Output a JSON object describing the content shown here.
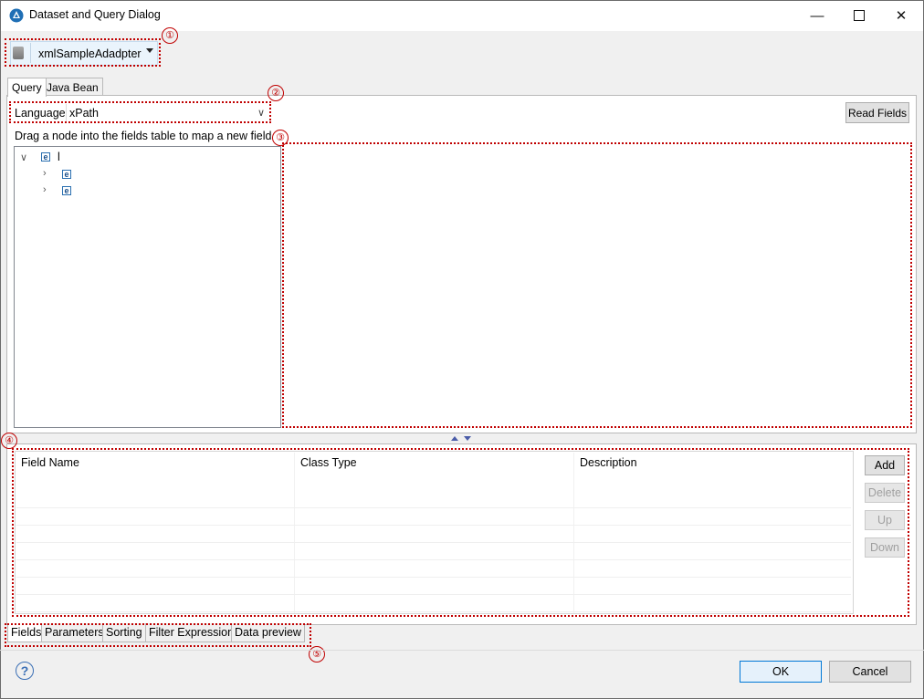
{
  "window": {
    "title": "Dataset and Query Dialog",
    "minimize_icon": "minimize-icon",
    "maximize_icon": "maximize-icon",
    "close_icon": "close-icon"
  },
  "adapter": {
    "selected": "xmlSampleAdadpter",
    "icon": "database-icon"
  },
  "callouts": [
    "①",
    "②",
    "③",
    "④",
    "⑤"
  ],
  "query_tabs": [
    {
      "label": "Query",
      "active": true
    },
    {
      "label": "Java Bean",
      "active": false
    }
  ],
  "language": {
    "label": "Language",
    "value": "xPath"
  },
  "read_fields_label": "Read Fields",
  "drag_hint": "Drag a node into the fields table to map a new field",
  "tree": {
    "root": {
      "label": "l",
      "icon": "e"
    },
    "children": [
      {
        "label": "",
        "icon": "e"
      },
      {
        "label": "",
        "icon": "e"
      }
    ]
  },
  "fields_table": {
    "columns": [
      "Field Name",
      "Class Type",
      "Description"
    ],
    "rows": []
  },
  "side_buttons": [
    {
      "label": "Add",
      "enabled": true
    },
    {
      "label": "Delete",
      "enabled": false
    },
    {
      "label": "Up",
      "enabled": false
    },
    {
      "label": "Down",
      "enabled": false
    }
  ],
  "bottom_tabs": [
    {
      "label": "Fields",
      "active": true
    },
    {
      "label": "Parameters",
      "active": false
    },
    {
      "label": "Sorting",
      "active": false
    },
    {
      "label": "Filter Expression",
      "active": false
    },
    {
      "label": "Data preview",
      "active": false
    }
  ],
  "footer": {
    "help_icon": "help-icon",
    "ok_label": "OK",
    "cancel_label": "Cancel"
  },
  "colors": {
    "callout": "#c00000",
    "ok_border": "#0078d7"
  }
}
